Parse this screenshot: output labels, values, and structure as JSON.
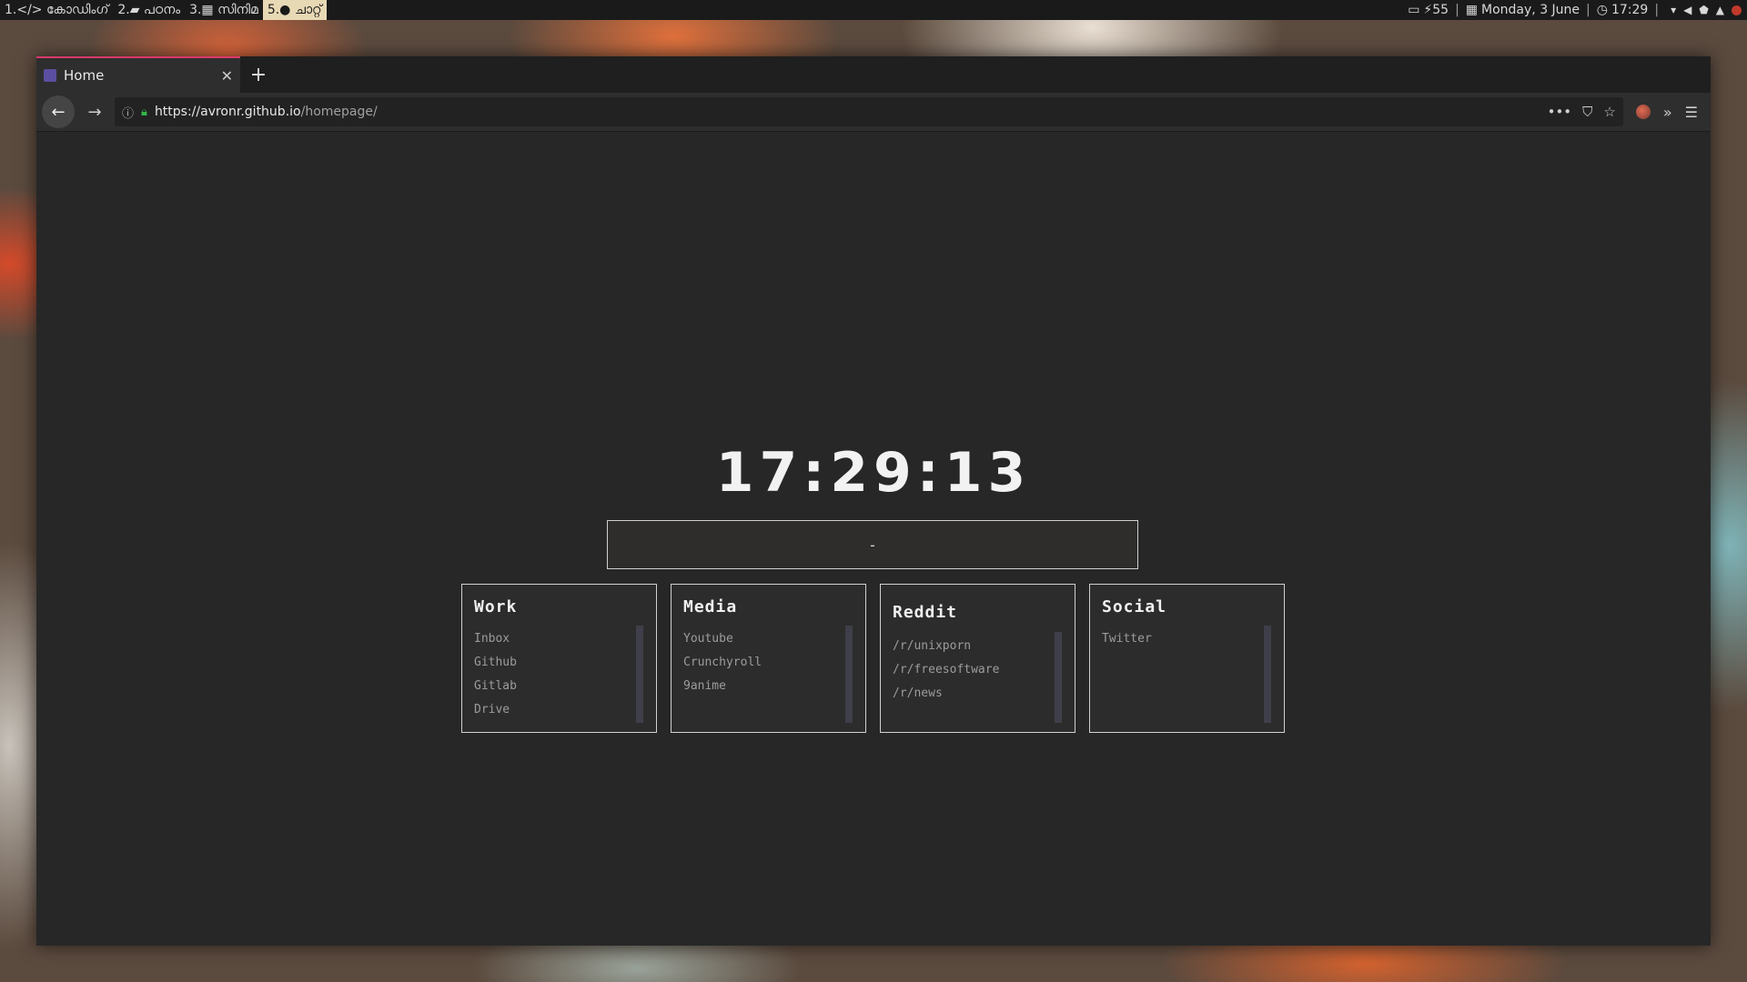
{
  "topbar": {
    "workspaces": [
      {
        "label": "1.</> കോഡിംഗ്",
        "active": false
      },
      {
        "label": "2.▰ പഠനം",
        "active": false
      },
      {
        "label": "3.▦ സിനിമ",
        "active": false
      },
      {
        "label": "5.● ചാറ്റ്",
        "active": true
      }
    ],
    "battery": "⚡55",
    "date": "Monday, 3 June",
    "time": "17:29"
  },
  "browser": {
    "tab_title": "Home",
    "url_host": "https://avronr.github.io",
    "url_path": "/homepage/"
  },
  "page": {
    "clock": "17:29:13",
    "search_value": "-",
    "cards": [
      {
        "title": "Work",
        "links": [
          "Inbox",
          "Github",
          "Gitlab",
          "Drive"
        ]
      },
      {
        "title": "Media",
        "links": [
          "Youtube",
          "Crunchyroll",
          "9anime"
        ]
      },
      {
        "title": "Reddit",
        "links": [
          "/r/unixporn",
          "/r/freesoftware",
          "/r/news"
        ]
      },
      {
        "title": "Social",
        "links": [
          "Twitter"
        ]
      }
    ]
  },
  "colors": {
    "tab_accent": "#d9386c",
    "lock_green": "#35b34a",
    "active_workspace": "#e8d9b5"
  }
}
